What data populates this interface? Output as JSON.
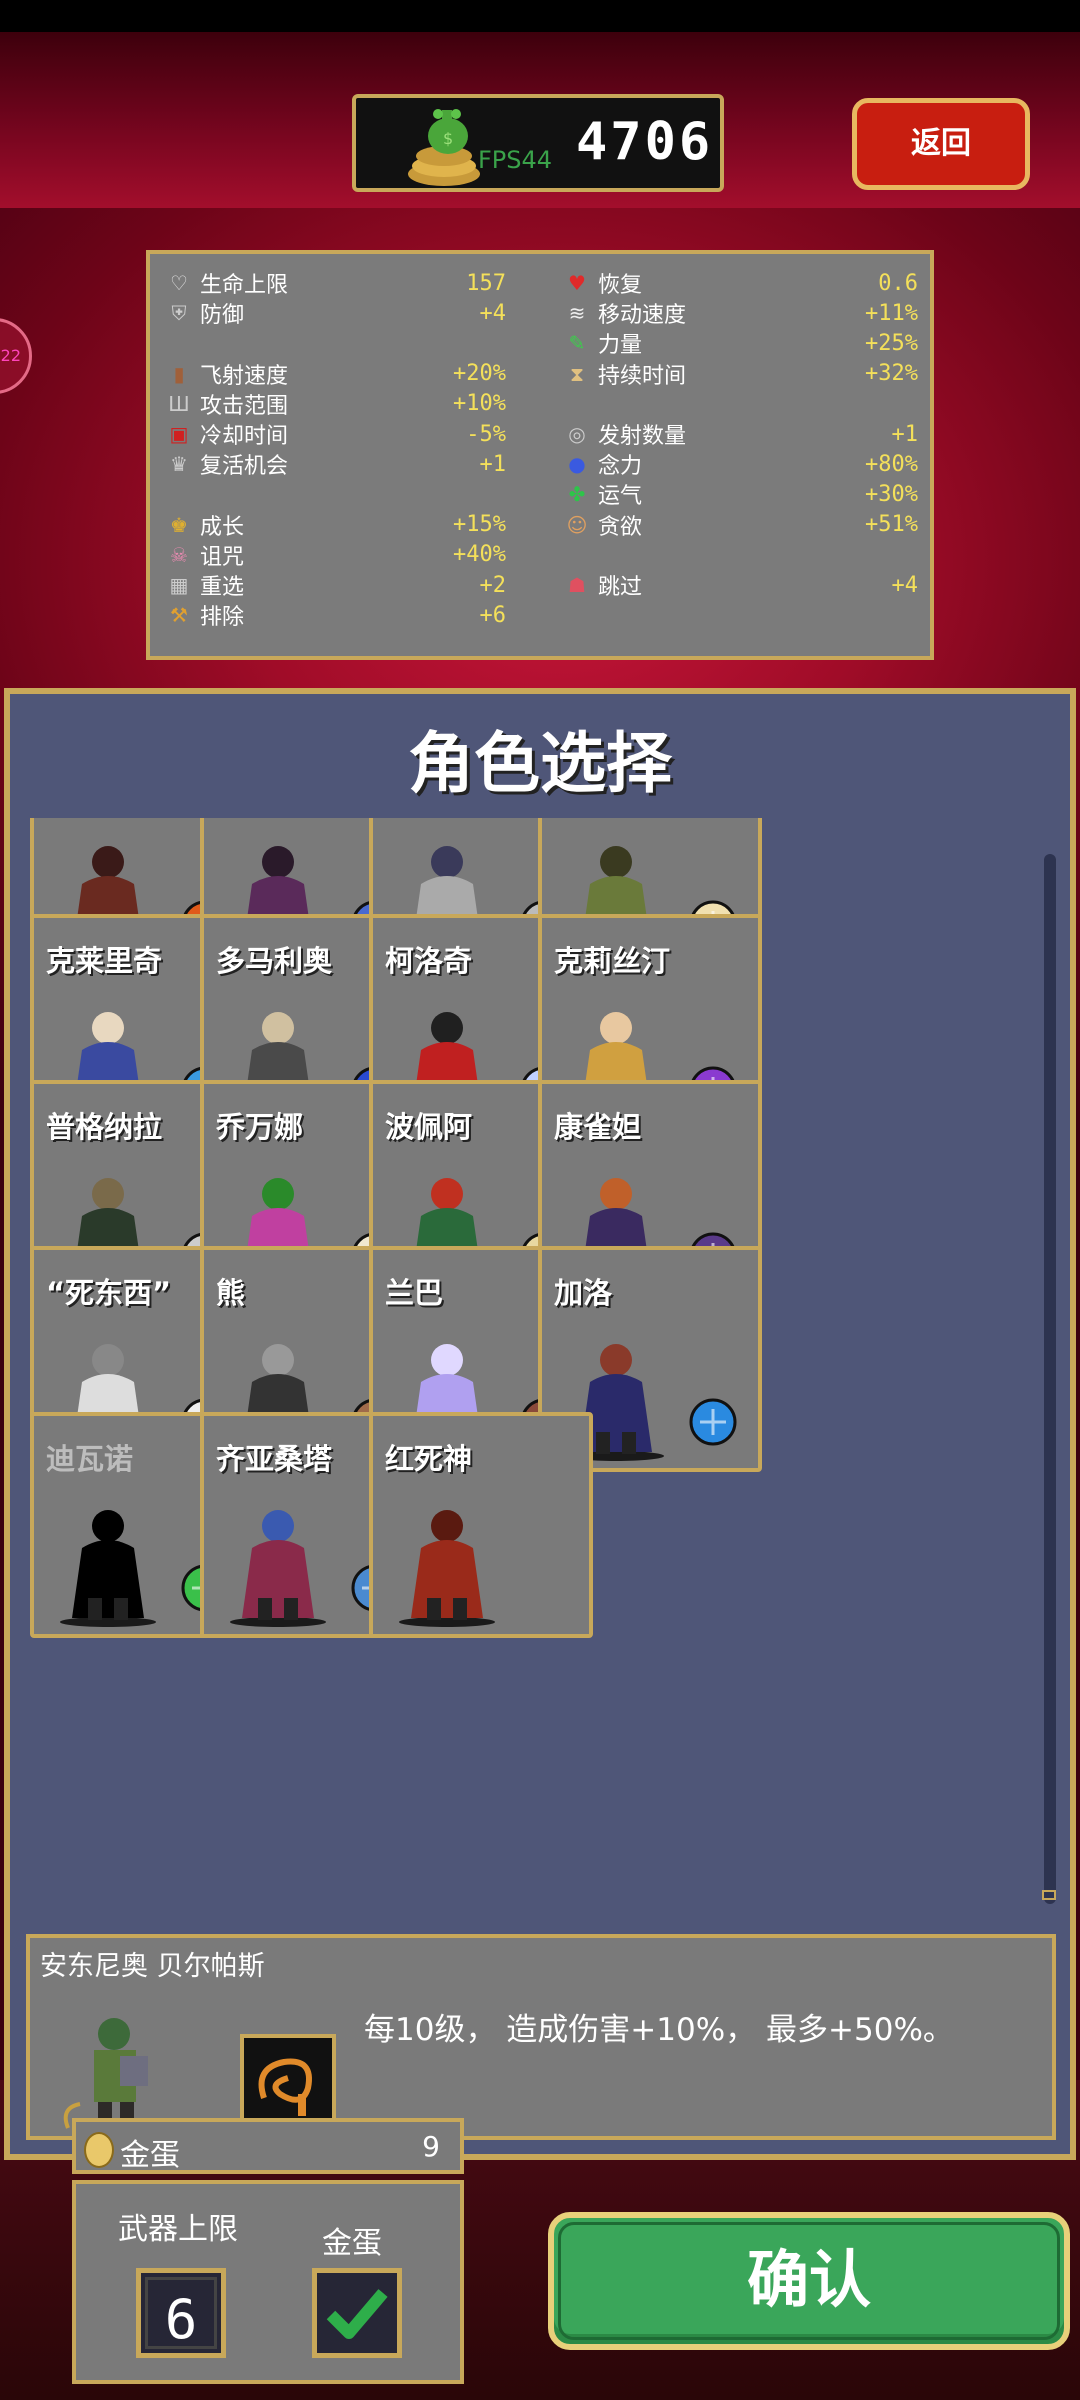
{
  "top": {
    "fps_label": "FPS44",
    "gold": "4706",
    "back_label": "返回",
    "side_badge": "22"
  },
  "stats": {
    "left": [
      {
        "label": "生命上限",
        "value": "157",
        "icon": "heart-outline-icon"
      },
      {
        "label": "防御",
        "value": "+4",
        "icon": "armor-icon"
      },
      {
        "label": "飞射速度",
        "value": "+20%",
        "icon": "book-icon"
      },
      {
        "label": "攻击范围",
        "value": "+10%",
        "icon": "candelabra-icon"
      },
      {
        "label": "冷却时间",
        "value": "-5%",
        "icon": "tome-icon"
      },
      {
        "label": "复活机会",
        "value": "+1",
        "icon": "tiara-icon"
      },
      {
        "label": "成长",
        "value": "+15%",
        "icon": "crown-icon"
      },
      {
        "label": "诅咒",
        "value": "+40%",
        "icon": "skull-icon"
      },
      {
        "label": "重选",
        "value": "+2",
        "icon": "dice-icon"
      },
      {
        "label": "排除",
        "value": "+6",
        "icon": "axe-icon"
      }
    ],
    "right": [
      {
        "label": "恢复",
        "value": "0.6",
        "icon": "red-heart-icon"
      },
      {
        "label": "移动速度",
        "value": "+11%",
        "icon": "wings-icon"
      },
      {
        "label": "力量",
        "value": "+25%",
        "icon": "leaf-icon"
      },
      {
        "label": "持续时间",
        "value": "+32%",
        "icon": "hourglass-icon"
      },
      {
        "label": "发射数量",
        "value": "+1",
        "icon": "duplicator-icon"
      },
      {
        "label": "念力",
        "value": "+80%",
        "icon": "blue-orb-icon"
      },
      {
        "label": "运气",
        "value": "+30%",
        "icon": "clover-icon"
      },
      {
        "label": "贪欲",
        "value": "+51%",
        "icon": "mask-icon"
      },
      {
        "label": "跳过",
        "value": "+4",
        "icon": "skip-skull-icon"
      }
    ]
  },
  "panel": {
    "title": "角色选择"
  },
  "characters": [
    {
      "name": "",
      "weapon": "torch-icon"
    },
    {
      "name": "",
      "weapon": "clock-lancet-icon"
    },
    {
      "name": "",
      "weapon": "axe-icon"
    },
    {
      "name": "",
      "weapon": "egg-icon"
    },
    {
      "name": "克莱里奇",
      "weapon": "holy-water-icon"
    },
    {
      "name": "多马利奥",
      "weapon": "king-bible-icon"
    },
    {
      "name": "柯洛奇",
      "weapon": "cross-icon"
    },
    {
      "name": "克莉丝汀",
      "weapon": "pentagram-icon"
    },
    {
      "name": "普格纳拉",
      "weapon": "pistols-icon"
    },
    {
      "name": "乔万娜",
      "weapon": "peachone-icon"
    },
    {
      "name": "波佩阿",
      "weapon": "song-scroll-icon"
    },
    {
      "name": "康雀妲",
      "weapon": "cone-icon"
    },
    {
      "name": "“死东西”",
      "weapon": "bone-icon"
    },
    {
      "name": "熊",
      "weapon": "cherry-bomb-icon"
    },
    {
      "name": "兰巴",
      "weapon": "carrello-icon"
    },
    {
      "name": "加洛",
      "weapon": "celestial-dusting-icon"
    },
    {
      "name": "迪瓦诺",
      "weapon": "leaf-sprout-icon",
      "locked": true
    },
    {
      "name": "齐亚桑塔",
      "weapon": "runetracer-icon"
    },
    {
      "name": "红死神",
      "weapon": ""
    }
  ],
  "selected": {
    "name": "安东尼奥 贝尔帕斯",
    "description": "每10级， 造成伤害+10%， 最多+50%。",
    "weapon": "whip-icon"
  },
  "eggs": {
    "label": "金蛋",
    "count": "9"
  },
  "options": {
    "weapon_limit_label": "武器上限",
    "weapon_limit_value": "6",
    "golden_egg_label": "金蛋",
    "golden_egg_checked": true
  },
  "confirm_label": "确认"
}
